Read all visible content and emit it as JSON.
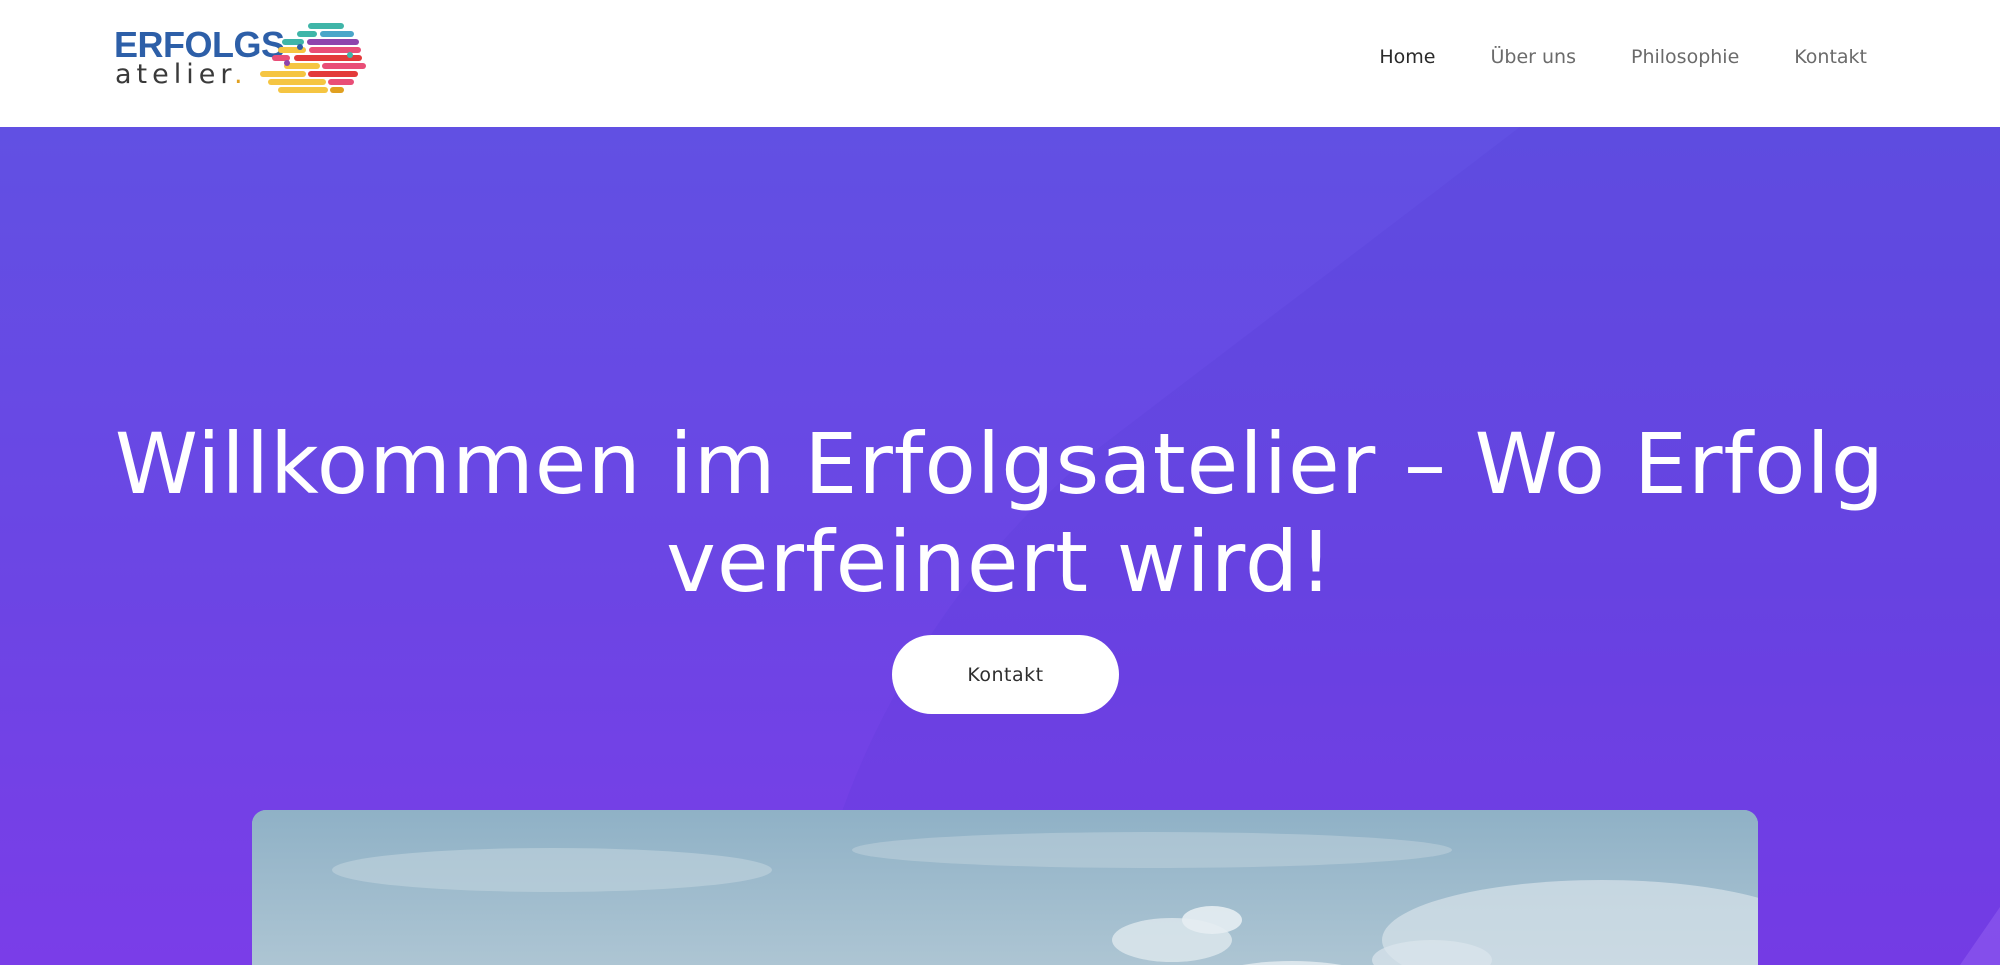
{
  "header": {
    "logo": {
      "word_top": "ERFOLGS",
      "word_bottom": "atelier",
      "dot": ".",
      "colors": [
        "#3fb5a8",
        "#e94e77",
        "#f5c542",
        "#e33a3a",
        "#8e44ad",
        "#2d5fa8"
      ]
    },
    "nav": [
      {
        "label": "Home",
        "active": true
      },
      {
        "label": "Über uns",
        "active": false
      },
      {
        "label": "Philosophie",
        "active": false
      },
      {
        "label": "Kontakt",
        "active": false
      }
    ]
  },
  "hero": {
    "title": "Willkommen im Erfolgsatelier – Wo Erfolg verfeinert wird!",
    "cta_label": "Kontakt",
    "colors": {
      "gradient_top": "#6150e3",
      "gradient_bottom": "#7a3de8",
      "button_bg": "#ffffff"
    },
    "image_description_icon": "sky-photo"
  }
}
